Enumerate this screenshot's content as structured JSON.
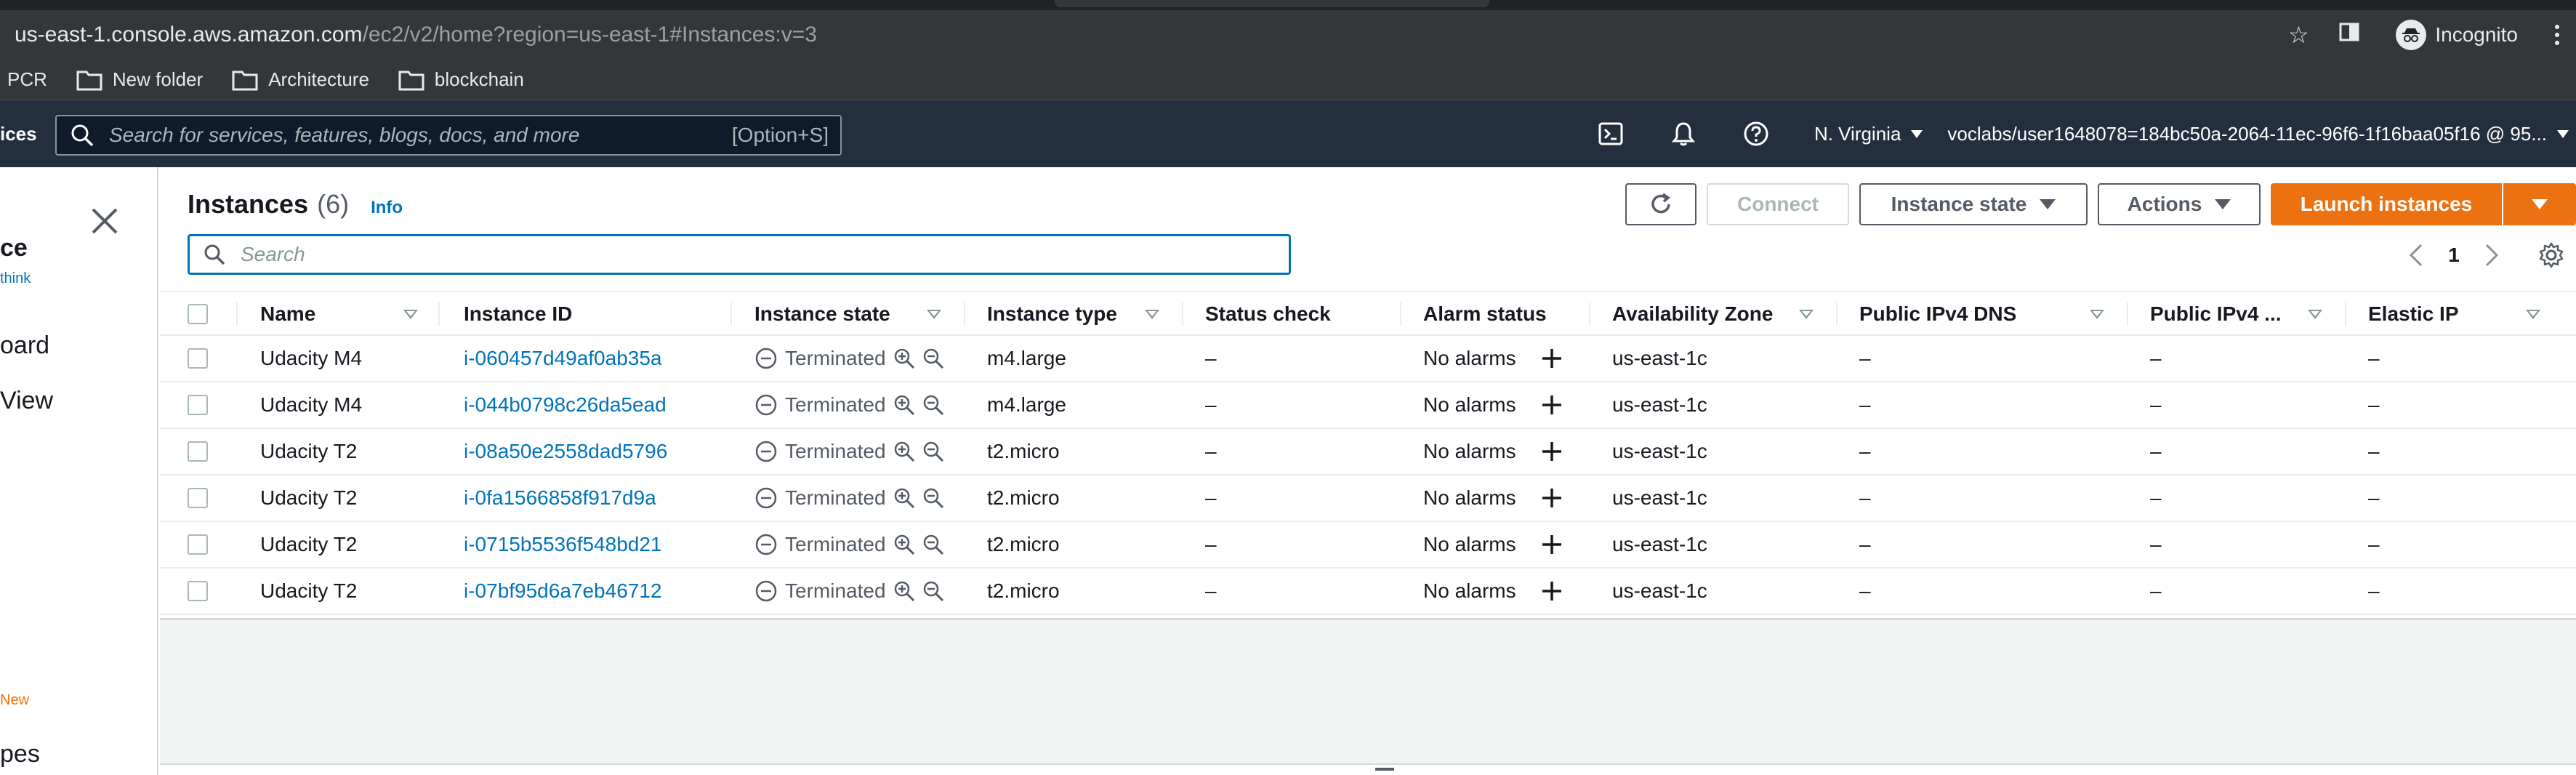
{
  "browser": {
    "url_host": "us-east-1.console.aws.amazon.com",
    "url_path": "/ec2/v2/home?region=us-east-1#Instances:v=3",
    "profile_label": "Incognito",
    "bookmarks": [
      {
        "label": "PCR",
        "folder": false
      },
      {
        "label": "New folder",
        "folder": true
      },
      {
        "label": "Architecture",
        "folder": true
      },
      {
        "label": "blockchain",
        "folder": true
      }
    ]
  },
  "aws_nav": {
    "services_label": "ices",
    "search_placeholder": "Search for services, features, blogs, docs, and more",
    "search_shortcut": "[Option+S]",
    "region": "N. Virginia",
    "account": "voclabs/user1648078=184bc50a-2064-11ec-96f6-1f16baa05f16 @ 95..."
  },
  "sidebar": {
    "heading": "ce",
    "link": "think",
    "item_dashboard": "oard",
    "item_view": "View",
    "badge_new": "New",
    "item_types": "pes"
  },
  "panel": {
    "title": "Instances",
    "count": "(6)",
    "info": "Info",
    "search_placeholder": "Search",
    "page": "1"
  },
  "toolbar": {
    "connect": "Connect",
    "instance_state": "Instance state",
    "actions": "Actions",
    "launch": "Launch instances"
  },
  "table": {
    "columns": {
      "name": "Name",
      "instance_id": "Instance ID",
      "instance_state": "Instance state",
      "instance_type": "Instance type",
      "status_check": "Status check",
      "alarm_status": "Alarm status",
      "az": "Availability Zone",
      "ipv4_dns": "Public IPv4 DNS",
      "ipv4": "Public IPv4 ...",
      "elastic_ip": "Elastic IP"
    },
    "rows": [
      {
        "name": "Udacity M4",
        "id": "i-060457d49af0ab35a",
        "state": "Terminated",
        "type": "m4.large",
        "status": "–",
        "alarm": "No alarms",
        "az": "us-east-1c",
        "dns": "–",
        "ipv4": "–",
        "eip": "–"
      },
      {
        "name": "Udacity M4",
        "id": "i-044b0798c26da5ead",
        "state": "Terminated",
        "type": "m4.large",
        "status": "–",
        "alarm": "No alarms",
        "az": "us-east-1c",
        "dns": "–",
        "ipv4": "–",
        "eip": "–"
      },
      {
        "name": "Udacity T2",
        "id": "i-08a50e2558dad5796",
        "state": "Terminated",
        "type": "t2.micro",
        "status": "–",
        "alarm": "No alarms",
        "az": "us-east-1c",
        "dns": "–",
        "ipv4": "–",
        "eip": "–"
      },
      {
        "name": "Udacity T2",
        "id": "i-0fa1566858f917d9a",
        "state": "Terminated",
        "type": "t2.micro",
        "status": "–",
        "alarm": "No alarms",
        "az": "us-east-1c",
        "dns": "–",
        "ipv4": "–",
        "eip": "–"
      },
      {
        "name": "Udacity T2",
        "id": "i-0715b5536f548bd21",
        "state": "Terminated",
        "type": "t2.micro",
        "status": "–",
        "alarm": "No alarms",
        "az": "us-east-1c",
        "dns": "–",
        "ipv4": "–",
        "eip": "–"
      },
      {
        "name": "Udacity T2",
        "id": "i-07bf95d6a7eb46712",
        "state": "Terminated",
        "type": "t2.micro",
        "status": "–",
        "alarm": "No alarms",
        "az": "us-east-1c",
        "dns": "–",
        "ipv4": "–",
        "eip": "–"
      }
    ]
  },
  "colors": {
    "aws_nav_bg": "#232f3e",
    "primary_orange": "#ec7211",
    "link_blue": "#0073bb"
  },
  "icons": [
    "star-icon",
    "sidebar-toggle-icon",
    "incognito-icon",
    "kebab-menu-icon",
    "folder-icon",
    "search-icon",
    "cloudshell-icon",
    "bell-icon",
    "help-icon",
    "close-icon",
    "refresh-icon",
    "chevron-left-icon",
    "chevron-right-icon",
    "settings-gear-icon",
    "terminated-icon",
    "zoom-in-icon",
    "zoom-out-icon",
    "plus-icon"
  ]
}
